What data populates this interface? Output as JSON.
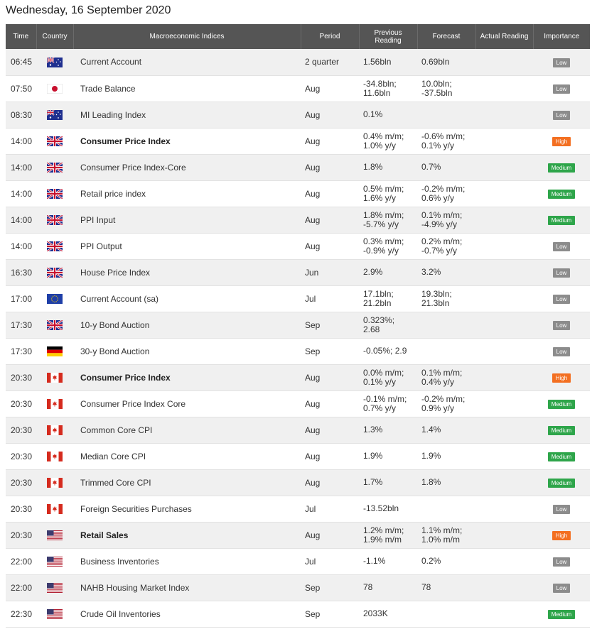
{
  "page_title": "Wednesday, 16 September 2020",
  "columns": [
    "Time",
    "Country",
    "Macroeconomic Indices",
    "Period",
    "Previous Reading",
    "Forecast",
    "Actual Reading",
    "Importance"
  ],
  "colors": {
    "header_bg": "#555555",
    "low": "#8c8c8c",
    "medium": "#2ea54a",
    "high": "#f36f21"
  },
  "rows": [
    {
      "time": "06:45",
      "country": "au",
      "flag_icon": "australia-flag-icon",
      "name": "Current Account",
      "bold": false,
      "period": "2 quarter",
      "previous": "1.56bln",
      "forecast": "0.69bln",
      "actual": "",
      "importance": "Low"
    },
    {
      "time": "07:50",
      "country": "jp",
      "flag_icon": "japan-flag-icon",
      "name": "Trade Balance",
      "bold": false,
      "period": "Aug",
      "previous": "-34.8bln;\n11.6bln",
      "forecast": "10.0bln;\n-37.5bln",
      "actual": "",
      "importance": "Low"
    },
    {
      "time": "08:30",
      "country": "au",
      "flag_icon": "australia-flag-icon",
      "name": "MI Leading Index",
      "bold": false,
      "period": "Aug",
      "previous": "0.1%",
      "forecast": "",
      "actual": "",
      "importance": "Low"
    },
    {
      "time": "14:00",
      "country": "gb",
      "flag_icon": "uk-flag-icon",
      "name": "Consumer Price Index",
      "bold": true,
      "period": "Aug",
      "previous": "0.4% m/m;\n1.0% y/y",
      "forecast": "-0.6% m/m;\n0.1% y/y",
      "actual": "",
      "importance": "High"
    },
    {
      "time": "14:00",
      "country": "gb",
      "flag_icon": "uk-flag-icon",
      "name": "Consumer Price Index-Core",
      "bold": false,
      "period": "Aug",
      "previous": "1.8%",
      "forecast": "0.7%",
      "actual": "",
      "importance": "Medium"
    },
    {
      "time": "14:00",
      "country": "gb",
      "flag_icon": "uk-flag-icon",
      "name": "Retail price index",
      "bold": false,
      "period": "Aug",
      "previous": "0.5% m/m;\n1.6% y/y",
      "forecast": "-0.2% m/m;\n0.6% y/y",
      "actual": "",
      "importance": "Medium"
    },
    {
      "time": "14:00",
      "country": "gb",
      "flag_icon": "uk-flag-icon",
      "name": "PPI Input",
      "bold": false,
      "period": "Aug",
      "previous": "1.8% m/m;\n-5.7% y/y",
      "forecast": "0.1% m/m;\n-4.9% y/y",
      "actual": "",
      "importance": "Medium"
    },
    {
      "time": "14:00",
      "country": "gb",
      "flag_icon": "uk-flag-icon",
      "name": "PPI Output",
      "bold": false,
      "period": "Aug",
      "previous": "0.3% m/m;\n-0.9% y/y",
      "forecast": "0.2% m/m;\n-0.7% y/y",
      "actual": "",
      "importance": "Low"
    },
    {
      "time": "16:30",
      "country": "gb",
      "flag_icon": "uk-flag-icon",
      "name": "House Price Index",
      "bold": false,
      "period": "Jun",
      "previous": "2.9%",
      "forecast": "3.2%",
      "actual": "",
      "importance": "Low"
    },
    {
      "time": "17:00",
      "country": "eu",
      "flag_icon": "eu-flag-icon",
      "name": "Current Account (sa)",
      "bold": false,
      "period": "Jul",
      "previous": "17.1bln;\n21.2bln",
      "forecast": "19.3bln;\n21.3bln",
      "actual": "",
      "importance": "Low"
    },
    {
      "time": "17:30",
      "country": "gb",
      "flag_icon": "uk-flag-icon",
      "name": "10-y Bond Auction",
      "bold": false,
      "period": "Sep",
      "previous": "0.323%;\n2.68",
      "forecast": "",
      "actual": "",
      "importance": "Low"
    },
    {
      "time": "17:30",
      "country": "de",
      "flag_icon": "germany-flag-icon",
      "name": "30-y Bond Auction",
      "bold": false,
      "period": "Sep",
      "previous": "-0.05%; 2.9",
      "forecast": "",
      "actual": "",
      "importance": "Low"
    },
    {
      "time": "20:30",
      "country": "ca",
      "flag_icon": "canada-flag-icon",
      "name": "Consumer Price Index",
      "bold": true,
      "period": "Aug",
      "previous": "0.0% m/m;\n0.1% y/y",
      "forecast": "0.1% m/m;\n0.4% y/y",
      "actual": "",
      "importance": "High"
    },
    {
      "time": "20:30",
      "country": "ca",
      "flag_icon": "canada-flag-icon",
      "name": "Consumer Price Index Core",
      "bold": false,
      "period": "Aug",
      "previous": "-0.1% m/m;\n0.7% y/y",
      "forecast": "-0.2% m/m;\n0.9% y/y",
      "actual": "",
      "importance": "Medium"
    },
    {
      "time": "20:30",
      "country": "ca",
      "flag_icon": "canada-flag-icon",
      "name": "Common Core CPI",
      "bold": false,
      "period": "Aug",
      "previous": "1.3%",
      "forecast": "1.4%",
      "actual": "",
      "importance": "Medium"
    },
    {
      "time": "20:30",
      "country": "ca",
      "flag_icon": "canada-flag-icon",
      "name": "Median Core CPI",
      "bold": false,
      "period": "Aug",
      "previous": "1.9%",
      "forecast": "1.9%",
      "actual": "",
      "importance": "Medium"
    },
    {
      "time": "20:30",
      "country": "ca",
      "flag_icon": "canada-flag-icon",
      "name": "Trimmed Core CPI",
      "bold": false,
      "period": "Aug",
      "previous": "1.7%",
      "forecast": "1.8%",
      "actual": "",
      "importance": "Medium"
    },
    {
      "time": "20:30",
      "country": "ca",
      "flag_icon": "canada-flag-icon",
      "name": "Foreign Securities Purchases",
      "bold": false,
      "period": "Jul",
      "previous": "-13.52bln",
      "forecast": "",
      "actual": "",
      "importance": "Low"
    },
    {
      "time": "20:30",
      "country": "us",
      "flag_icon": "usa-flag-icon",
      "name": "Retail Sales",
      "bold": true,
      "period": "Aug",
      "previous": "1.2% m/m;\n1.9% m/m",
      "forecast": "1.1% m/m;\n1.0% m/m",
      "actual": "",
      "importance": "High"
    },
    {
      "time": "22:00",
      "country": "us",
      "flag_icon": "usa-flag-icon",
      "name": "Business Inventories",
      "bold": false,
      "period": "Jul",
      "previous": "-1.1%",
      "forecast": "0.2%",
      "actual": "",
      "importance": "Low"
    },
    {
      "time": "22:00",
      "country": "us",
      "flag_icon": "usa-flag-icon",
      "name": "NAHB Housing Market Index",
      "bold": false,
      "period": "Sep",
      "previous": "78",
      "forecast": "78",
      "actual": "",
      "importance": "Low"
    },
    {
      "time": "22:30",
      "country": "us",
      "flag_icon": "usa-flag-icon",
      "name": "Crude Oil Inventories",
      "bold": false,
      "period": "Sep",
      "previous": "2033K",
      "forecast": "",
      "actual": "",
      "importance": "Medium"
    }
  ]
}
